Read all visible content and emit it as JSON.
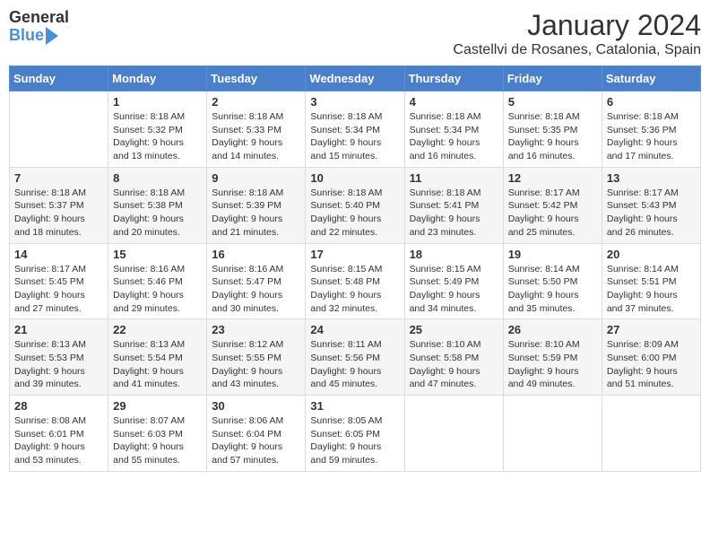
{
  "logo": {
    "general": "General",
    "blue": "Blue"
  },
  "title": "January 2024",
  "location": "Castellvi de Rosanes, Catalonia, Spain",
  "headers": [
    "Sunday",
    "Monday",
    "Tuesday",
    "Wednesday",
    "Thursday",
    "Friday",
    "Saturday"
  ],
  "weeks": [
    [
      {
        "day": "",
        "content": ""
      },
      {
        "day": "1",
        "content": "Sunrise: 8:18 AM\nSunset: 5:32 PM\nDaylight: 9 hours\nand 13 minutes."
      },
      {
        "day": "2",
        "content": "Sunrise: 8:18 AM\nSunset: 5:33 PM\nDaylight: 9 hours\nand 14 minutes."
      },
      {
        "day": "3",
        "content": "Sunrise: 8:18 AM\nSunset: 5:34 PM\nDaylight: 9 hours\nand 15 minutes."
      },
      {
        "day": "4",
        "content": "Sunrise: 8:18 AM\nSunset: 5:34 PM\nDaylight: 9 hours\nand 16 minutes."
      },
      {
        "day": "5",
        "content": "Sunrise: 8:18 AM\nSunset: 5:35 PM\nDaylight: 9 hours\nand 16 minutes."
      },
      {
        "day": "6",
        "content": "Sunrise: 8:18 AM\nSunset: 5:36 PM\nDaylight: 9 hours\nand 17 minutes."
      }
    ],
    [
      {
        "day": "7",
        "content": "Sunrise: 8:18 AM\nSunset: 5:37 PM\nDaylight: 9 hours\nand 18 minutes."
      },
      {
        "day": "8",
        "content": "Sunrise: 8:18 AM\nSunset: 5:38 PM\nDaylight: 9 hours\nand 20 minutes."
      },
      {
        "day": "9",
        "content": "Sunrise: 8:18 AM\nSunset: 5:39 PM\nDaylight: 9 hours\nand 21 minutes."
      },
      {
        "day": "10",
        "content": "Sunrise: 8:18 AM\nSunset: 5:40 PM\nDaylight: 9 hours\nand 22 minutes."
      },
      {
        "day": "11",
        "content": "Sunrise: 8:18 AM\nSunset: 5:41 PM\nDaylight: 9 hours\nand 23 minutes."
      },
      {
        "day": "12",
        "content": "Sunrise: 8:17 AM\nSunset: 5:42 PM\nDaylight: 9 hours\nand 25 minutes."
      },
      {
        "day": "13",
        "content": "Sunrise: 8:17 AM\nSunset: 5:43 PM\nDaylight: 9 hours\nand 26 minutes."
      }
    ],
    [
      {
        "day": "14",
        "content": "Sunrise: 8:17 AM\nSunset: 5:45 PM\nDaylight: 9 hours\nand 27 minutes."
      },
      {
        "day": "15",
        "content": "Sunrise: 8:16 AM\nSunset: 5:46 PM\nDaylight: 9 hours\nand 29 minutes."
      },
      {
        "day": "16",
        "content": "Sunrise: 8:16 AM\nSunset: 5:47 PM\nDaylight: 9 hours\nand 30 minutes."
      },
      {
        "day": "17",
        "content": "Sunrise: 8:15 AM\nSunset: 5:48 PM\nDaylight: 9 hours\nand 32 minutes."
      },
      {
        "day": "18",
        "content": "Sunrise: 8:15 AM\nSunset: 5:49 PM\nDaylight: 9 hours\nand 34 minutes."
      },
      {
        "day": "19",
        "content": "Sunrise: 8:14 AM\nSunset: 5:50 PM\nDaylight: 9 hours\nand 35 minutes."
      },
      {
        "day": "20",
        "content": "Sunrise: 8:14 AM\nSunset: 5:51 PM\nDaylight: 9 hours\nand 37 minutes."
      }
    ],
    [
      {
        "day": "21",
        "content": "Sunrise: 8:13 AM\nSunset: 5:53 PM\nDaylight: 9 hours\nand 39 minutes."
      },
      {
        "day": "22",
        "content": "Sunrise: 8:13 AM\nSunset: 5:54 PM\nDaylight: 9 hours\nand 41 minutes."
      },
      {
        "day": "23",
        "content": "Sunrise: 8:12 AM\nSunset: 5:55 PM\nDaylight: 9 hours\nand 43 minutes."
      },
      {
        "day": "24",
        "content": "Sunrise: 8:11 AM\nSunset: 5:56 PM\nDaylight: 9 hours\nand 45 minutes."
      },
      {
        "day": "25",
        "content": "Sunrise: 8:10 AM\nSunset: 5:58 PM\nDaylight: 9 hours\nand 47 minutes."
      },
      {
        "day": "26",
        "content": "Sunrise: 8:10 AM\nSunset: 5:59 PM\nDaylight: 9 hours\nand 49 minutes."
      },
      {
        "day": "27",
        "content": "Sunrise: 8:09 AM\nSunset: 6:00 PM\nDaylight: 9 hours\nand 51 minutes."
      }
    ],
    [
      {
        "day": "28",
        "content": "Sunrise: 8:08 AM\nSunset: 6:01 PM\nDaylight: 9 hours\nand 53 minutes."
      },
      {
        "day": "29",
        "content": "Sunrise: 8:07 AM\nSunset: 6:03 PM\nDaylight: 9 hours\nand 55 minutes."
      },
      {
        "day": "30",
        "content": "Sunrise: 8:06 AM\nSunset: 6:04 PM\nDaylight: 9 hours\nand 57 minutes."
      },
      {
        "day": "31",
        "content": "Sunrise: 8:05 AM\nSunset: 6:05 PM\nDaylight: 9 hours\nand 59 minutes."
      },
      {
        "day": "",
        "content": ""
      },
      {
        "day": "",
        "content": ""
      },
      {
        "day": "",
        "content": ""
      }
    ]
  ]
}
